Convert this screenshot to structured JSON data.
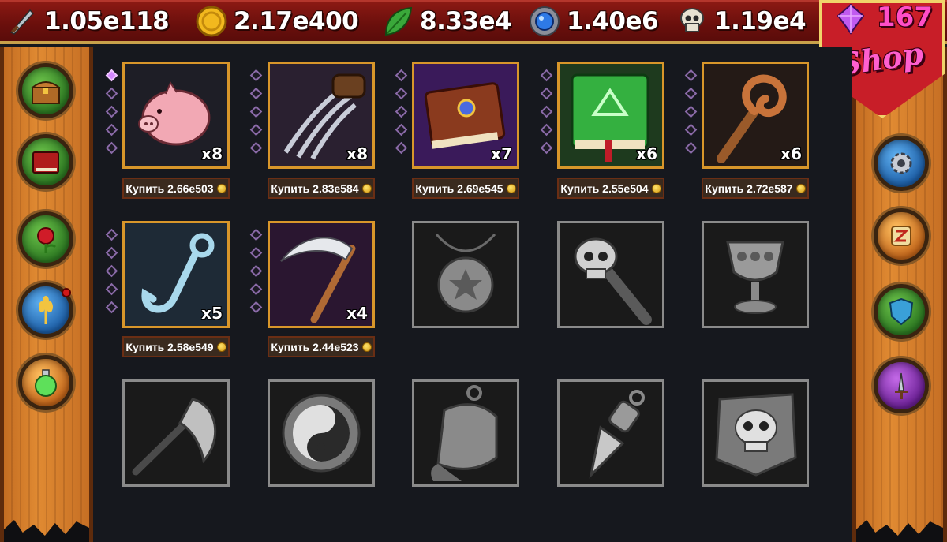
{
  "resources": [
    {
      "icon": "dagger-icon",
      "value": "1.05e118"
    },
    {
      "icon": "gold-coin-icon",
      "value": "2.17e400"
    },
    {
      "icon": "leaf-icon",
      "value": "8.33e4"
    },
    {
      "icon": "blue-orb-icon",
      "value": "1.40e6"
    },
    {
      "icon": "skull-icon",
      "value": "1.19e4"
    }
  ],
  "shop": {
    "gems": "167",
    "label": "Shop",
    "gem_icon": "purple-gem-icon"
  },
  "left_menu": [
    {
      "icon": "treasure-chest-icon",
      "color": "green"
    },
    {
      "icon": "red-book-icon",
      "color": "green"
    },
    {
      "icon": "rose-icon",
      "color": "green"
    },
    {
      "icon": "wheat-icon",
      "color": "blue",
      "notification": true
    },
    {
      "icon": "potion-icon",
      "color": "orange"
    }
  ],
  "right_menu": [
    {
      "icon": "gear-icon",
      "color": "blue"
    },
    {
      "icon": "scroll-icon",
      "color": "orange"
    },
    {
      "icon": "shield-icon",
      "color": "green"
    },
    {
      "icon": "sword-icon",
      "color": "purple"
    }
  ],
  "artifacts": [
    {
      "name": "piggy-bank",
      "count": "x8",
      "price": "Купить 2.66e503",
      "gems_filled": 1,
      "locked": false
    },
    {
      "name": "claws",
      "count": "x8",
      "price": "Купить 2.83e584",
      "gems_filled": 0,
      "locked": false
    },
    {
      "name": "spell-book",
      "count": "x7",
      "price": "Купить 2.69e545",
      "gems_filled": 0,
      "locked": false
    },
    {
      "name": "green-tome",
      "count": "x6",
      "price": "Купить 2.55e504",
      "gems_filled": 0,
      "locked": false
    },
    {
      "name": "spiral-staff",
      "count": "x6",
      "price": "Купить 2.72e587",
      "gems_filled": 0,
      "locked": false
    },
    {
      "name": "hook",
      "count": "x5",
      "price": "Купить 2.58e549",
      "gems_filled": 0,
      "locked": false
    },
    {
      "name": "scythe",
      "count": "x4",
      "price": "Купить 2.44e523",
      "gems_filled": 0,
      "locked": false
    },
    {
      "name": "star-amulet",
      "locked": true
    },
    {
      "name": "skull-staff",
      "locked": true
    },
    {
      "name": "goblet",
      "locked": true
    },
    {
      "name": "battle-axe",
      "locked": true
    },
    {
      "name": "yin-yang-token",
      "locked": true
    },
    {
      "name": "bell",
      "locked": true
    },
    {
      "name": "crystal-pendant",
      "locked": true
    },
    {
      "name": "skull-shield",
      "locked": true
    }
  ]
}
